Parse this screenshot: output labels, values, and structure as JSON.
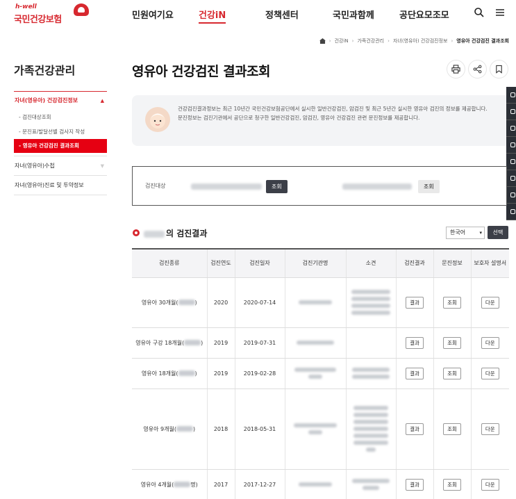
{
  "header": {
    "logo_tag": "h-well",
    "logo_name": "국민건강보험",
    "nav": [
      "민원여기요",
      "건강iN",
      "정책센터",
      "국민과함께",
      "공단요모조모"
    ],
    "active_nav": "건강iN"
  },
  "breadcrumb": [
    "건강iN",
    "가족건강관리",
    "자녀(영유아) 건강검진정보",
    "영유아 건강검진 결과조회"
  ],
  "sidebar": {
    "title": "가족건강관리",
    "items": [
      {
        "label": "자녀(영유아) 건강검진정보",
        "open": true,
        "sub": [
          "검진대상조회",
          "문진표/발달선별 검사지 작성",
          "영유아 건강검진 결과조회"
        ]
      },
      {
        "label": "자녀(영유아)수첩"
      },
      {
        "label": "자녀(영유아)진료 및 투약정보"
      }
    ]
  },
  "page_title": "영유아 건강검진 결과조회",
  "info": {
    "line1": "건강검진결과정보는 최근 10년간 국민건강보험공단에서 실시한 일반건강검진, 암검진 및 최근 5년간 실시한 영유아 검진의 정보를 제공합니다.",
    "line2": "문진정보는 검진기관에서 공단으로 청구한 일반건강검진, 암검진, 영유아 건강검진 관련 문진정보를 제공합니다."
  },
  "search": {
    "label": "검진대상",
    "btn1": "조회",
    "btn2": "조회"
  },
  "result": {
    "title_suffix": "의 검진결과",
    "language": "한국어",
    "select_btn": "선택"
  },
  "table": {
    "headers": [
      "검진종류",
      "검진연도",
      "검진일자",
      "검진기관명",
      "소견",
      "검진결과",
      "문진정보",
      "보호자 설명서"
    ],
    "rows": [
      {
        "type": "영유아 30개월(",
        "type_end": ")",
        "year": "2020",
        "date": "2020-07-14",
        "result": "결과",
        "survey": "조회",
        "guide": "다운"
      },
      {
        "type": "영유아 구강 18개월(",
        "type_end": ")",
        "year": "2019",
        "date": "2019-07-31",
        "result": "결과",
        "survey": "조회",
        "guide": "다운"
      },
      {
        "type": "영유아 18개월(",
        "type_end": ")",
        "year": "2019",
        "date": "2019-02-28",
        "result": "결과",
        "survey": "조회",
        "guide": "다운"
      },
      {
        "type": "영유아 9개월(",
        "type_end": ")",
        "year": "2018",
        "date": "2018-05-31",
        "result": "결과",
        "survey": "조회",
        "guide": "다운"
      },
      {
        "type": "영유아 4개월(",
        "type_end": "명)",
        "year": "2017",
        "date": "2017-12-27",
        "result": "결과",
        "survey": "조회",
        "guide": "다운"
      }
    ]
  },
  "colors": {
    "brand": "#d7282f",
    "active_menu": "#e60012",
    "dark_button": "#3c3f48"
  },
  "icons": [
    "search-icon",
    "menu-icon",
    "home-icon",
    "print-icon",
    "share-icon",
    "bookmark-icon"
  ]
}
